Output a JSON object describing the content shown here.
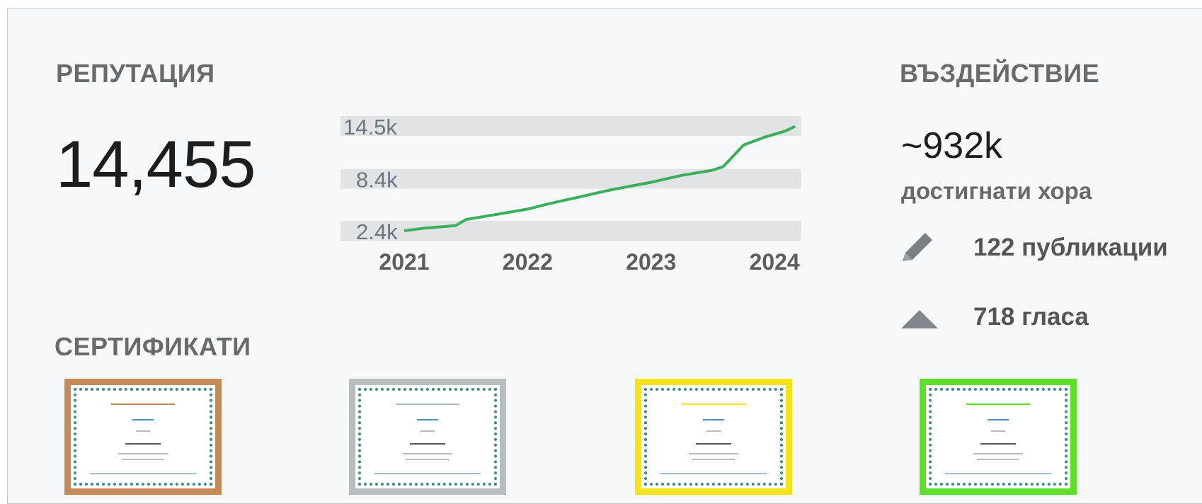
{
  "reputation": {
    "heading": "РЕПУТАЦИЯ",
    "value": "14,455"
  },
  "certificates": {
    "heading": "СЕРТИФИКАТИ",
    "items": [
      {
        "border_color": "#c48a5a"
      },
      {
        "border_color": "#b6bec0"
      },
      {
        "border_color": "#f4e21a"
      },
      {
        "border_color": "#5ee02a"
      }
    ]
  },
  "impact": {
    "heading": "ВЪЗДЕЙСТВИЕ",
    "value": "~932k",
    "sub": "достигнати хора",
    "posts": {
      "icon": "pencil-icon",
      "text": "122 публикации"
    },
    "votes": {
      "icon": "upvote-triangle-icon",
      "text": "718 гласа"
    }
  },
  "chart_data": {
    "type": "line",
    "yticks": [
      "14.5k",
      "8.4k",
      "2.4k"
    ],
    "ytick_values": [
      14500,
      8400,
      2400
    ],
    "xticks": [
      "2021",
      "2022",
      "2023",
      "2024"
    ],
    "x": [
      "2021-01",
      "2021-03",
      "2021-06",
      "2021-07",
      "2021-10",
      "2022-01",
      "2022-03",
      "2022-06",
      "2022-09",
      "2023-01",
      "2023-04",
      "2023-07",
      "2023-08",
      "2023-10",
      "2023-12",
      "2024-02",
      "2024-03"
    ],
    "values": [
      2400,
      2700,
      3000,
      3700,
      4300,
      4900,
      5500,
      6300,
      7100,
      8000,
      8800,
      9400,
      9800,
      12300,
      13200,
      13900,
      14455
    ],
    "line_color": "#3dae5e",
    "band_color": "#e1e3e5",
    "ylim": [
      2400,
      14500
    ]
  }
}
